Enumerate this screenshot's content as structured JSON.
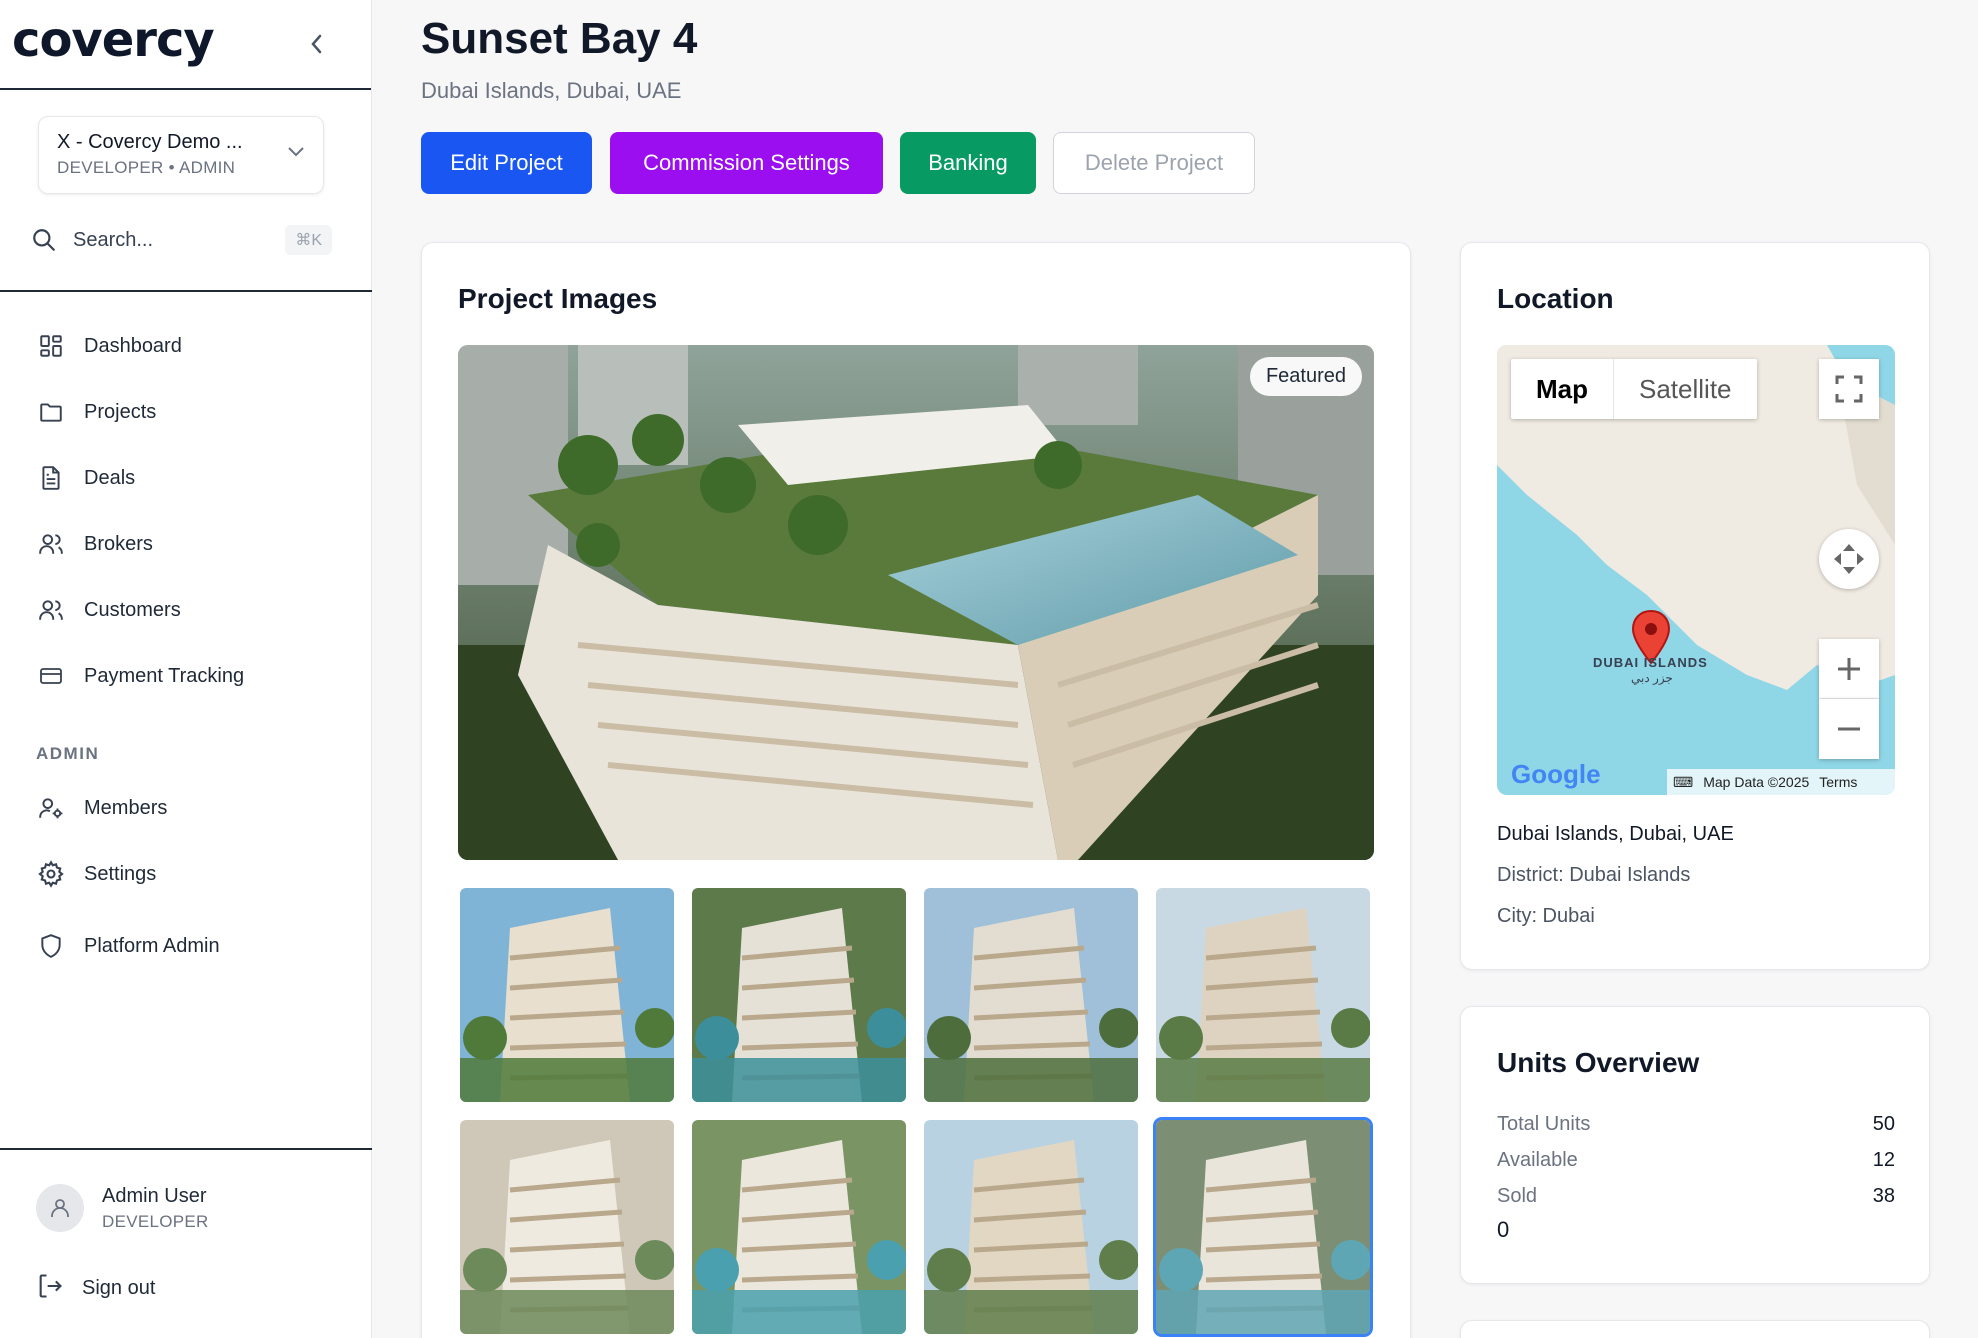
{
  "sidebar": {
    "logo": "covercy",
    "org": {
      "name": "X - Covercy Demo ...",
      "role": "DEVELOPER • ADMIN"
    },
    "search": {
      "placeholder": "Search...",
      "shortcut": "⌘K"
    },
    "nav_items": [
      {
        "label": "Dashboard",
        "icon": "dashboard-icon"
      },
      {
        "label": "Projects",
        "icon": "folder-icon"
      },
      {
        "label": "Deals",
        "icon": "document-icon"
      },
      {
        "label": "Brokers",
        "icon": "users-icon"
      },
      {
        "label": "Customers",
        "icon": "users-icon"
      },
      {
        "label": "Payment Tracking",
        "icon": "credit-card-icon"
      }
    ],
    "admin_section": "ADMIN",
    "admin_items": [
      {
        "label": "Members",
        "icon": "user-cog-icon"
      },
      {
        "label": "Settings",
        "icon": "gear-icon"
      },
      {
        "label": "Platform Admin",
        "icon": "shield-icon"
      }
    ],
    "user": {
      "name": "Admin User",
      "role": "DEVELOPER"
    },
    "signout": "Sign out"
  },
  "header": {
    "title": "Sunset Bay 4",
    "subtitle": "Dubai Islands, Dubai, UAE",
    "buttons": {
      "edit": "Edit Project",
      "commission": "Commission Settings",
      "banking": "Banking",
      "delete": "Delete Project"
    }
  },
  "images": {
    "title": "Project Images",
    "featured_badge": "Featured",
    "thumb_count": 8
  },
  "location": {
    "title": "Location",
    "map": {
      "map_tab": "Map",
      "satellite_tab": "Satellite",
      "place_label": "DUBAI ISLANDS",
      "place_label_ar": "جزر دبي",
      "google": "Google",
      "map_data": "Map Data ©2025",
      "terms": "Terms"
    },
    "address": "Dubai Islands, Dubai, UAE",
    "district": "District: Dubai Islands",
    "city": "City: Dubai"
  },
  "units": {
    "title": "Units Overview",
    "rows": [
      {
        "label": "Total Units",
        "value": "50"
      },
      {
        "label": "Available",
        "value": "12"
      },
      {
        "label": "Sold",
        "value": "38"
      }
    ],
    "extra": "0"
  }
}
